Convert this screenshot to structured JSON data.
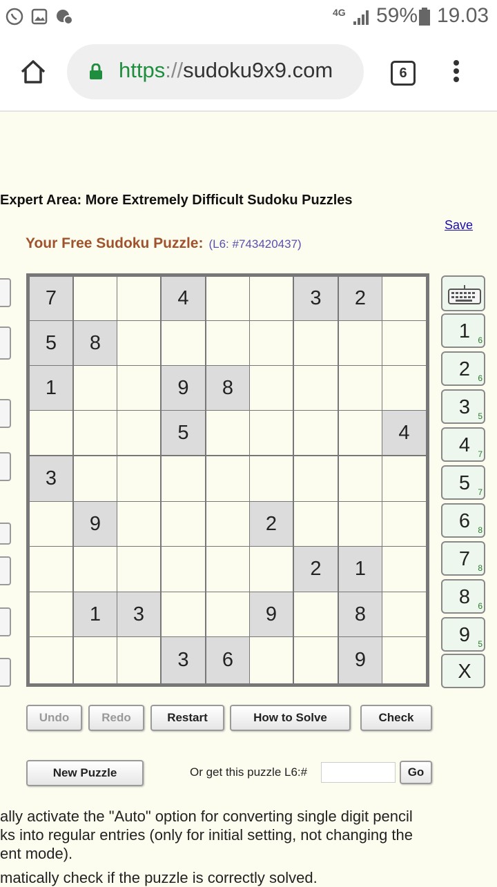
{
  "status_bar": {
    "network": "4G",
    "battery": "59%",
    "time": "19.03"
  },
  "browser": {
    "url_scheme": "https",
    "url_sep": "://",
    "url_host": "sudoku9x9.com",
    "tab_count": "6"
  },
  "page": {
    "heading": "Expert Area: More Extremely Difficult Sudoku Puzzles",
    "save_link": "Save",
    "puzzle_title": "Your Free Sudoku Puzzle:",
    "puzzle_id": "(L6: #743420437)"
  },
  "grid": [
    [
      "7",
      "",
      "",
      "4",
      "",
      "",
      "3",
      "2",
      ""
    ],
    [
      "5",
      "8",
      "",
      "",
      "",
      "",
      "",
      "",
      ""
    ],
    [
      "1",
      "",
      "",
      "9",
      "8",
      "",
      "",
      "",
      ""
    ],
    [
      "",
      "",
      "",
      "5",
      "",
      "",
      "",
      "",
      "4"
    ],
    [
      "3",
      "",
      "",
      "",
      "",
      "",
      "",
      "",
      ""
    ],
    [
      "",
      "9",
      "",
      "",
      "",
      "2",
      "",
      "",
      ""
    ],
    [
      "",
      "",
      "",
      "",
      "",
      "",
      "2",
      "1",
      ""
    ],
    [
      "",
      "1",
      "3",
      "",
      "",
      "9",
      "",
      "8",
      ""
    ],
    [
      "",
      "",
      "",
      "3",
      "6",
      "",
      "",
      "9",
      ""
    ]
  ],
  "numpad": {
    "keys": [
      {
        "digit": "1",
        "count": "6"
      },
      {
        "digit": "2",
        "count": "6"
      },
      {
        "digit": "3",
        "count": "5"
      },
      {
        "digit": "4",
        "count": "7"
      },
      {
        "digit": "5",
        "count": "7"
      },
      {
        "digit": "6",
        "count": "8"
      },
      {
        "digit": "7",
        "count": "8"
      },
      {
        "digit": "8",
        "count": "6"
      },
      {
        "digit": "9",
        "count": "5"
      }
    ],
    "clear": "X",
    "keyboard_icon": "keyboard-icon"
  },
  "buttons": {
    "undo": "Undo",
    "redo": "Redo",
    "restart": "Restart",
    "how_to_solve": "How to Solve",
    "check": "Check",
    "new_puzzle": "New Puzzle",
    "go": "Go"
  },
  "get_puzzle_label": "Or get this puzzle L6:#",
  "get_puzzle_value": "",
  "text_lines": [
    "ally activate the \"Auto\" option for converting single digit pencil",
    "ks into regular entries (only for initial setting, not changing the",
    "ent mode).",
    "matically check if the puzzle is correctly solved."
  ]
}
